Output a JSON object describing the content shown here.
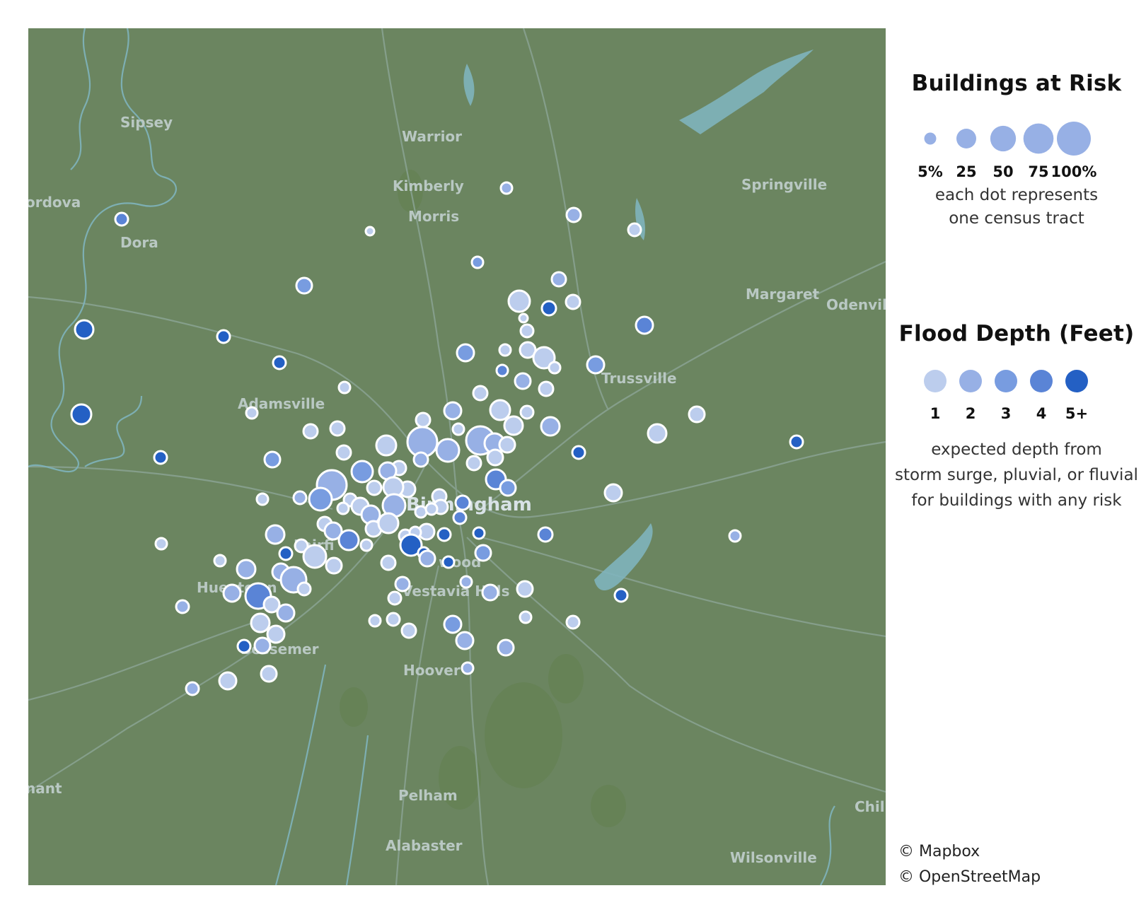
{
  "legend": {
    "size_title": "Buildings at Risk",
    "size_labels": [
      "5%",
      "25",
      "50",
      "75",
      "100%"
    ],
    "size_values": [
      5,
      25,
      50,
      75,
      100
    ],
    "size_note_line1": "each dot represents",
    "size_note_line2": "one census tract",
    "color_title": "Flood Depth (Feet)",
    "color_labels": [
      "1",
      "2",
      "3",
      "4",
      "5+"
    ],
    "colors": [
      "#bccded",
      "#97b0e5",
      "#789ce0",
      "#5a84d6",
      "#2460c4"
    ],
    "color_note_line1": "expected depth from",
    "color_note_line2": "storm surge, pluvial, or fluvial",
    "color_note_line3": "for buildings with any risk"
  },
  "credits": {
    "line1": "© Mapbox",
    "line2": "© OpenStreetMap"
  },
  "places": {
    "sipsey": "Sipsey",
    "warrior": "Warrior",
    "kimberly": "Kimberly",
    "morris": "Morris",
    "cordova": "ordova",
    "dora": "Dora",
    "springville": "Springville",
    "margaret": "Margaret",
    "odenville": "Odenvill",
    "adamsville": "Adamsville",
    "trussville": "Trussville",
    "birmingham": "Birmingham",
    "fairfield": "Fairfi",
    "hueytown": "Hueytown",
    "homewood": "wood",
    "vestavia": "Vestavia Hills",
    "bessemer": "Bessemer",
    "hoover": "Hoover",
    "pelham": "Pelham",
    "alabaster": "Alabaster",
    "wilsonville": "Wilsonville",
    "tenant": "nant",
    "chil": "Chil"
  }
}
